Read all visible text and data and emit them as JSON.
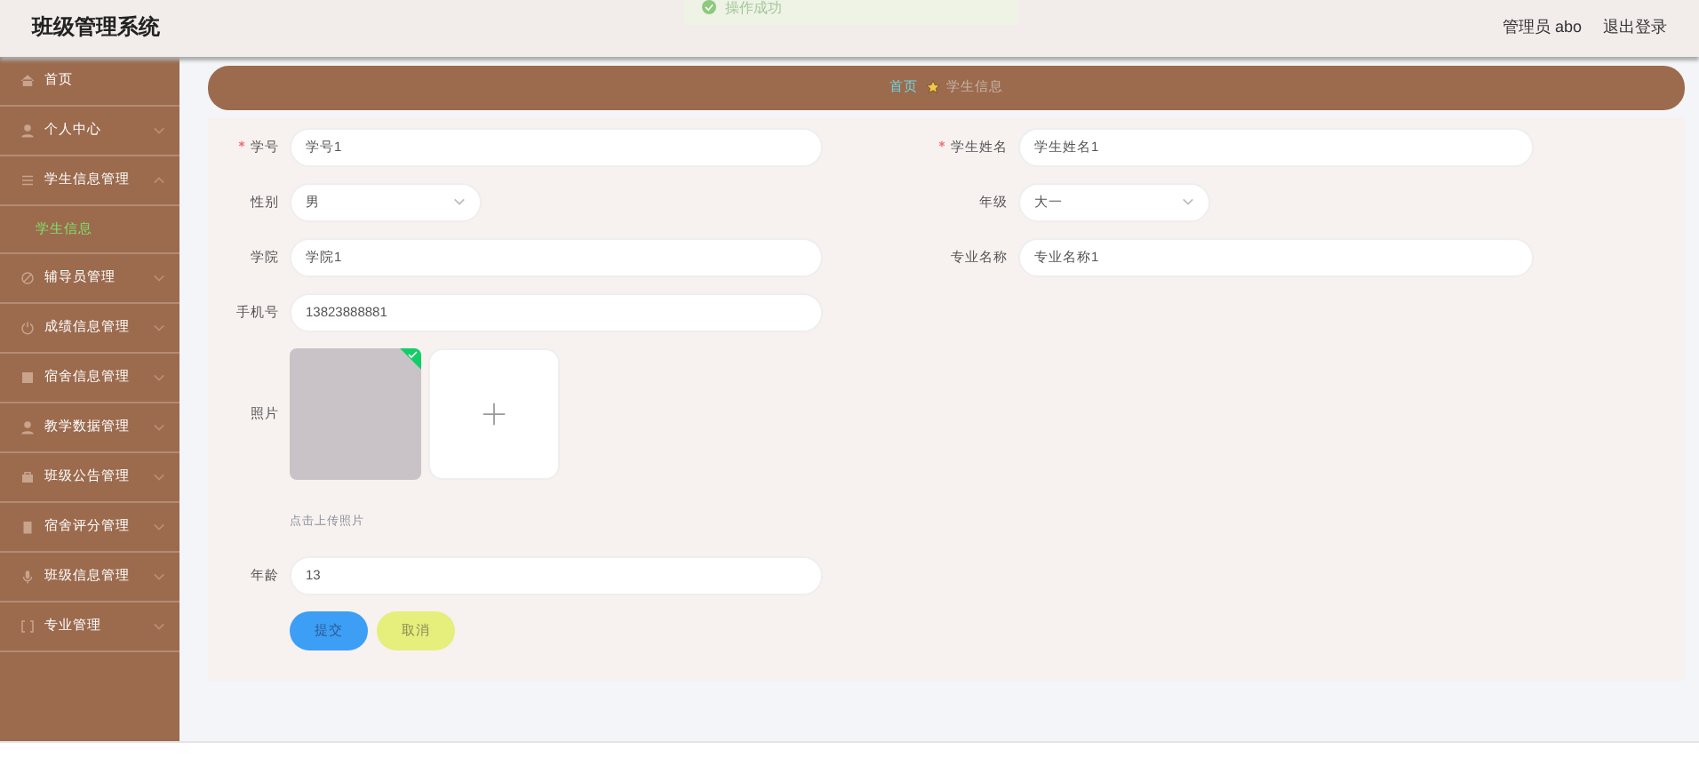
{
  "header": {
    "title": "班级管理系统",
    "user": "管理员 abo",
    "logout": "退出登录"
  },
  "toast": {
    "message": "操作成功"
  },
  "sidebar": {
    "items": [
      {
        "label": "首页",
        "selected": false
      },
      {
        "label": "个人中心",
        "selected": false,
        "expanded": false
      },
      {
        "label": "学生信息管理",
        "selected": false,
        "expanded": true,
        "children": [
          {
            "label": "学生信息",
            "selected": true
          }
        ]
      },
      {
        "label": "辅导员管理",
        "selected": false,
        "expanded": false
      },
      {
        "label": "成绩信息管理",
        "selected": false,
        "expanded": false
      },
      {
        "label": "宿舍信息管理",
        "selected": false,
        "expanded": false
      },
      {
        "label": "教学数据管理",
        "selected": false,
        "expanded": false
      },
      {
        "label": "班级公告管理",
        "selected": false,
        "expanded": false
      },
      {
        "label": "宿舍评分管理",
        "selected": false,
        "expanded": false
      },
      {
        "label": "班级信息管理",
        "selected": false,
        "expanded": false
      },
      {
        "label": "专业管理",
        "selected": false,
        "expanded": false
      }
    ]
  },
  "breadcrumb": [
    {
      "label": "首页",
      "kind": "link"
    },
    {
      "label": "学生信息",
      "kind": "current"
    }
  ],
  "form": {
    "rows": [
      {
        "kind": "fields",
        "fields": [
          {
            "label": "学号",
            "value": "学号1",
            "required": true,
            "kind": "text"
          },
          {
            "label": "学生姓名",
            "value": "学生姓名1",
            "required": true,
            "kind": "text"
          }
        ]
      },
      {
        "kind": "fields",
        "fields": [
          {
            "label": "性别",
            "value": "男",
            "required": false,
            "kind": "select"
          },
          {
            "label": "年级",
            "value": "大一",
            "required": false,
            "kind": "select"
          }
        ]
      },
      {
        "kind": "fields",
        "fields": [
          {
            "label": "学院",
            "value": "学院1",
            "required": false,
            "kind": "text"
          },
          {
            "label": "专业名称",
            "value": "专业名称1",
            "required": false,
            "kind": "text"
          }
        ]
      },
      {
        "kind": "fields",
        "fields": [
          {
            "label": "手机号",
            "value": "13823888881",
            "required": false,
            "kind": "text"
          }
        ]
      },
      {
        "kind": "upload",
        "label": "照片",
        "uploaded": true,
        "hint": "点击上传照片"
      },
      {
        "kind": "fields",
        "fields": [
          {
            "label": "年龄",
            "value": "13",
            "required": false,
            "kind": "text"
          }
        ]
      }
    ],
    "buttons": [
      {
        "label": "提交",
        "kind": "primary"
      },
      {
        "label": "取消",
        "kind": "cancel"
      }
    ]
  }
}
